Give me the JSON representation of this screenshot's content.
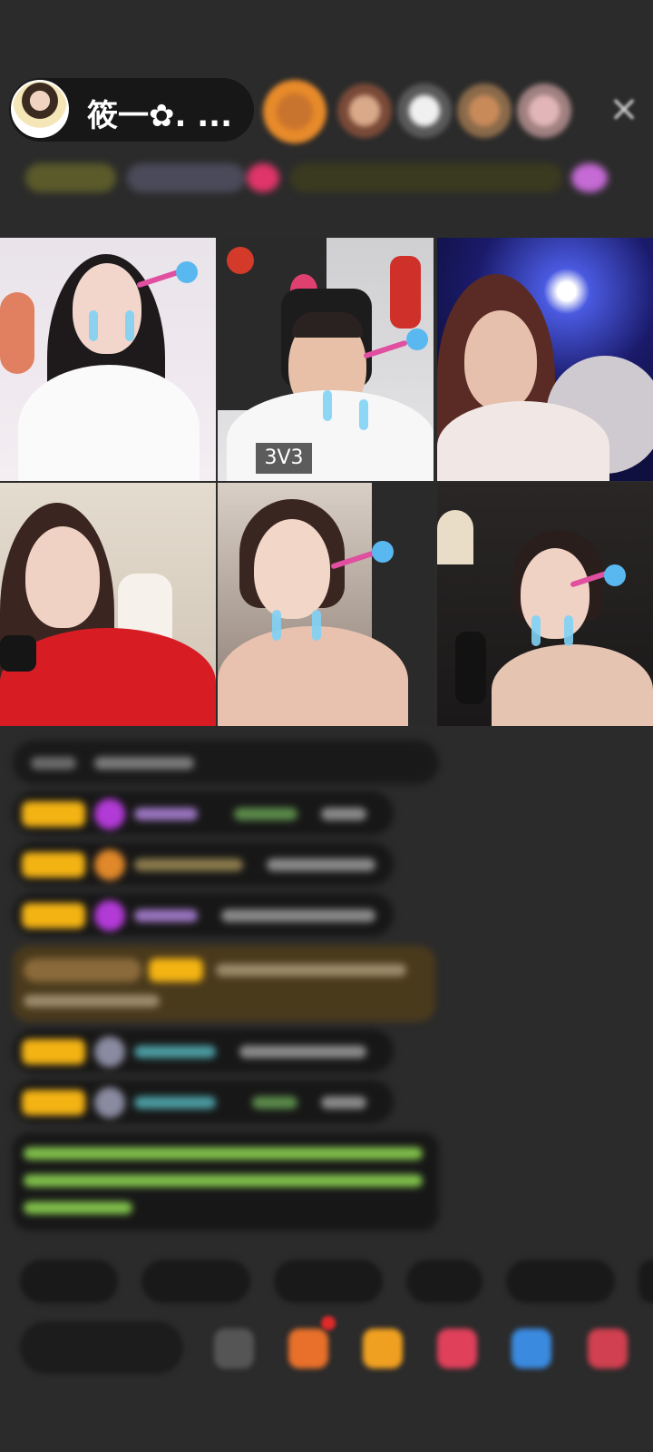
{
  "header": {
    "host_name": "筱一✿. ..."
  },
  "video_grid": {
    "tiles": [
      {
        "position": "top-left"
      },
      {
        "position": "top-center",
        "label": "3V3"
      },
      {
        "position": "top-right"
      },
      {
        "position": "bottom-left"
      },
      {
        "position": "bottom-center"
      },
      {
        "position": "bottom-right"
      }
    ]
  },
  "colors": {
    "background": "#2b2b2b",
    "level_badge": "#f3b313",
    "highlight_message": "#4a3a1c",
    "system_message_text": "#7fbf4a"
  },
  "icons": [
    "close-icon",
    "host-avatar",
    "viewer-avatar",
    "gift-icon",
    "share-icon",
    "more-icon"
  ]
}
